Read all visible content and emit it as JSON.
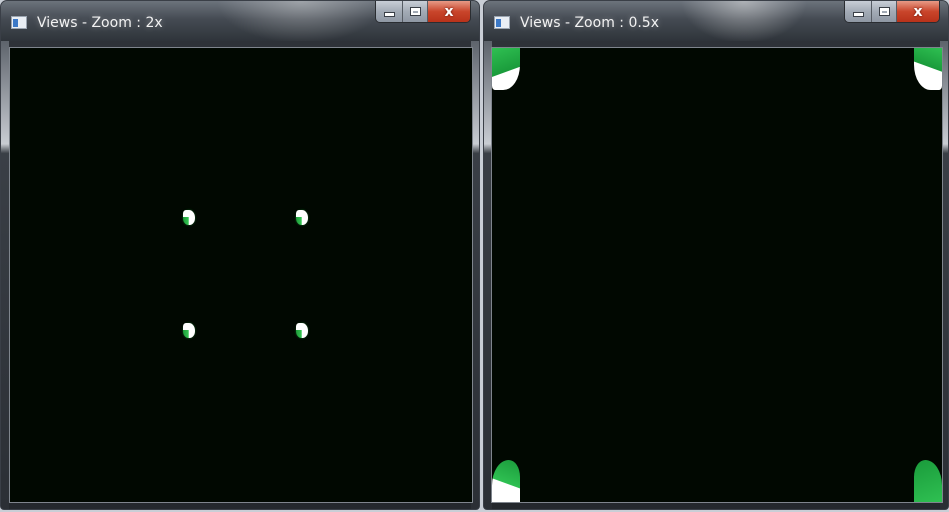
{
  "windows": [
    {
      "title": "Views - Zoom : 2x",
      "zoom": "2x",
      "controls": {
        "minimize_icon": "minimize-icon",
        "maximize_icon": "maximize-icon",
        "close_glyph": "x"
      },
      "view": {
        "background": "#010801",
        "visible_marker_count": 4
      }
    },
    {
      "title": "Views - Zoom : 0.5x",
      "zoom": "0.5x",
      "controls": {
        "minimize_icon": "minimize-icon",
        "maximize_icon": "maximize-icon",
        "close_glyph": "x"
      },
      "view": {
        "background": "#010801",
        "visible_marker_count": 4
      }
    }
  ],
  "colors": {
    "marker_green": "#2fc052",
    "marker_white": "#ffffff",
    "close_red": "#c9452b"
  }
}
